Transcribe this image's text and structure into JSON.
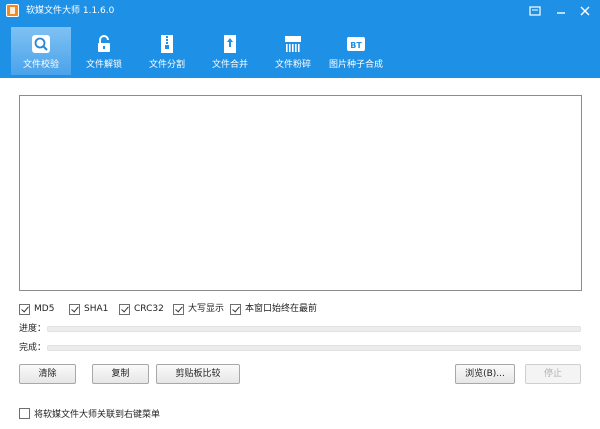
{
  "window": {
    "title": "软媒文件大师 1.1.6.0",
    "controls": {
      "menu": "menu-icon",
      "minimize": "minimize-icon",
      "close": "close-icon"
    }
  },
  "tabs": [
    {
      "label": "文件校验",
      "icon": "magnifier-icon",
      "active": true
    },
    {
      "label": "文件解锁",
      "icon": "unlock-icon",
      "active": false
    },
    {
      "label": "文件分割",
      "icon": "split-file-icon",
      "active": false
    },
    {
      "label": "文件合并",
      "icon": "merge-file-icon",
      "active": false
    },
    {
      "label": "文件粉碎",
      "icon": "shredder-icon",
      "active": false
    },
    {
      "label": "图片种子合成",
      "icon": "bt-icon",
      "active": false
    }
  ],
  "options": [
    {
      "label": "MD5",
      "checked": true
    },
    {
      "label": "SHA1",
      "checked": true
    },
    {
      "label": "CRC32",
      "checked": true
    },
    {
      "label": "大写显示",
      "checked": true
    },
    {
      "label": "本窗口始终在最前",
      "checked": true
    }
  ],
  "progress": {
    "label": "进度：",
    "value": 0
  },
  "completion": {
    "label": "完成：",
    "value": 0
  },
  "buttons": {
    "clear": "清除",
    "copy": "复制",
    "clipboard_compare": "剪贴板比较",
    "browse": "浏览(B)...",
    "stop": "停止"
  },
  "context_menu_option": {
    "label": "将软媒文件大师关联到右键菜单",
    "checked": false
  },
  "colors": {
    "accent": "#1e90e6",
    "active_tab": "#6fb7f0"
  }
}
